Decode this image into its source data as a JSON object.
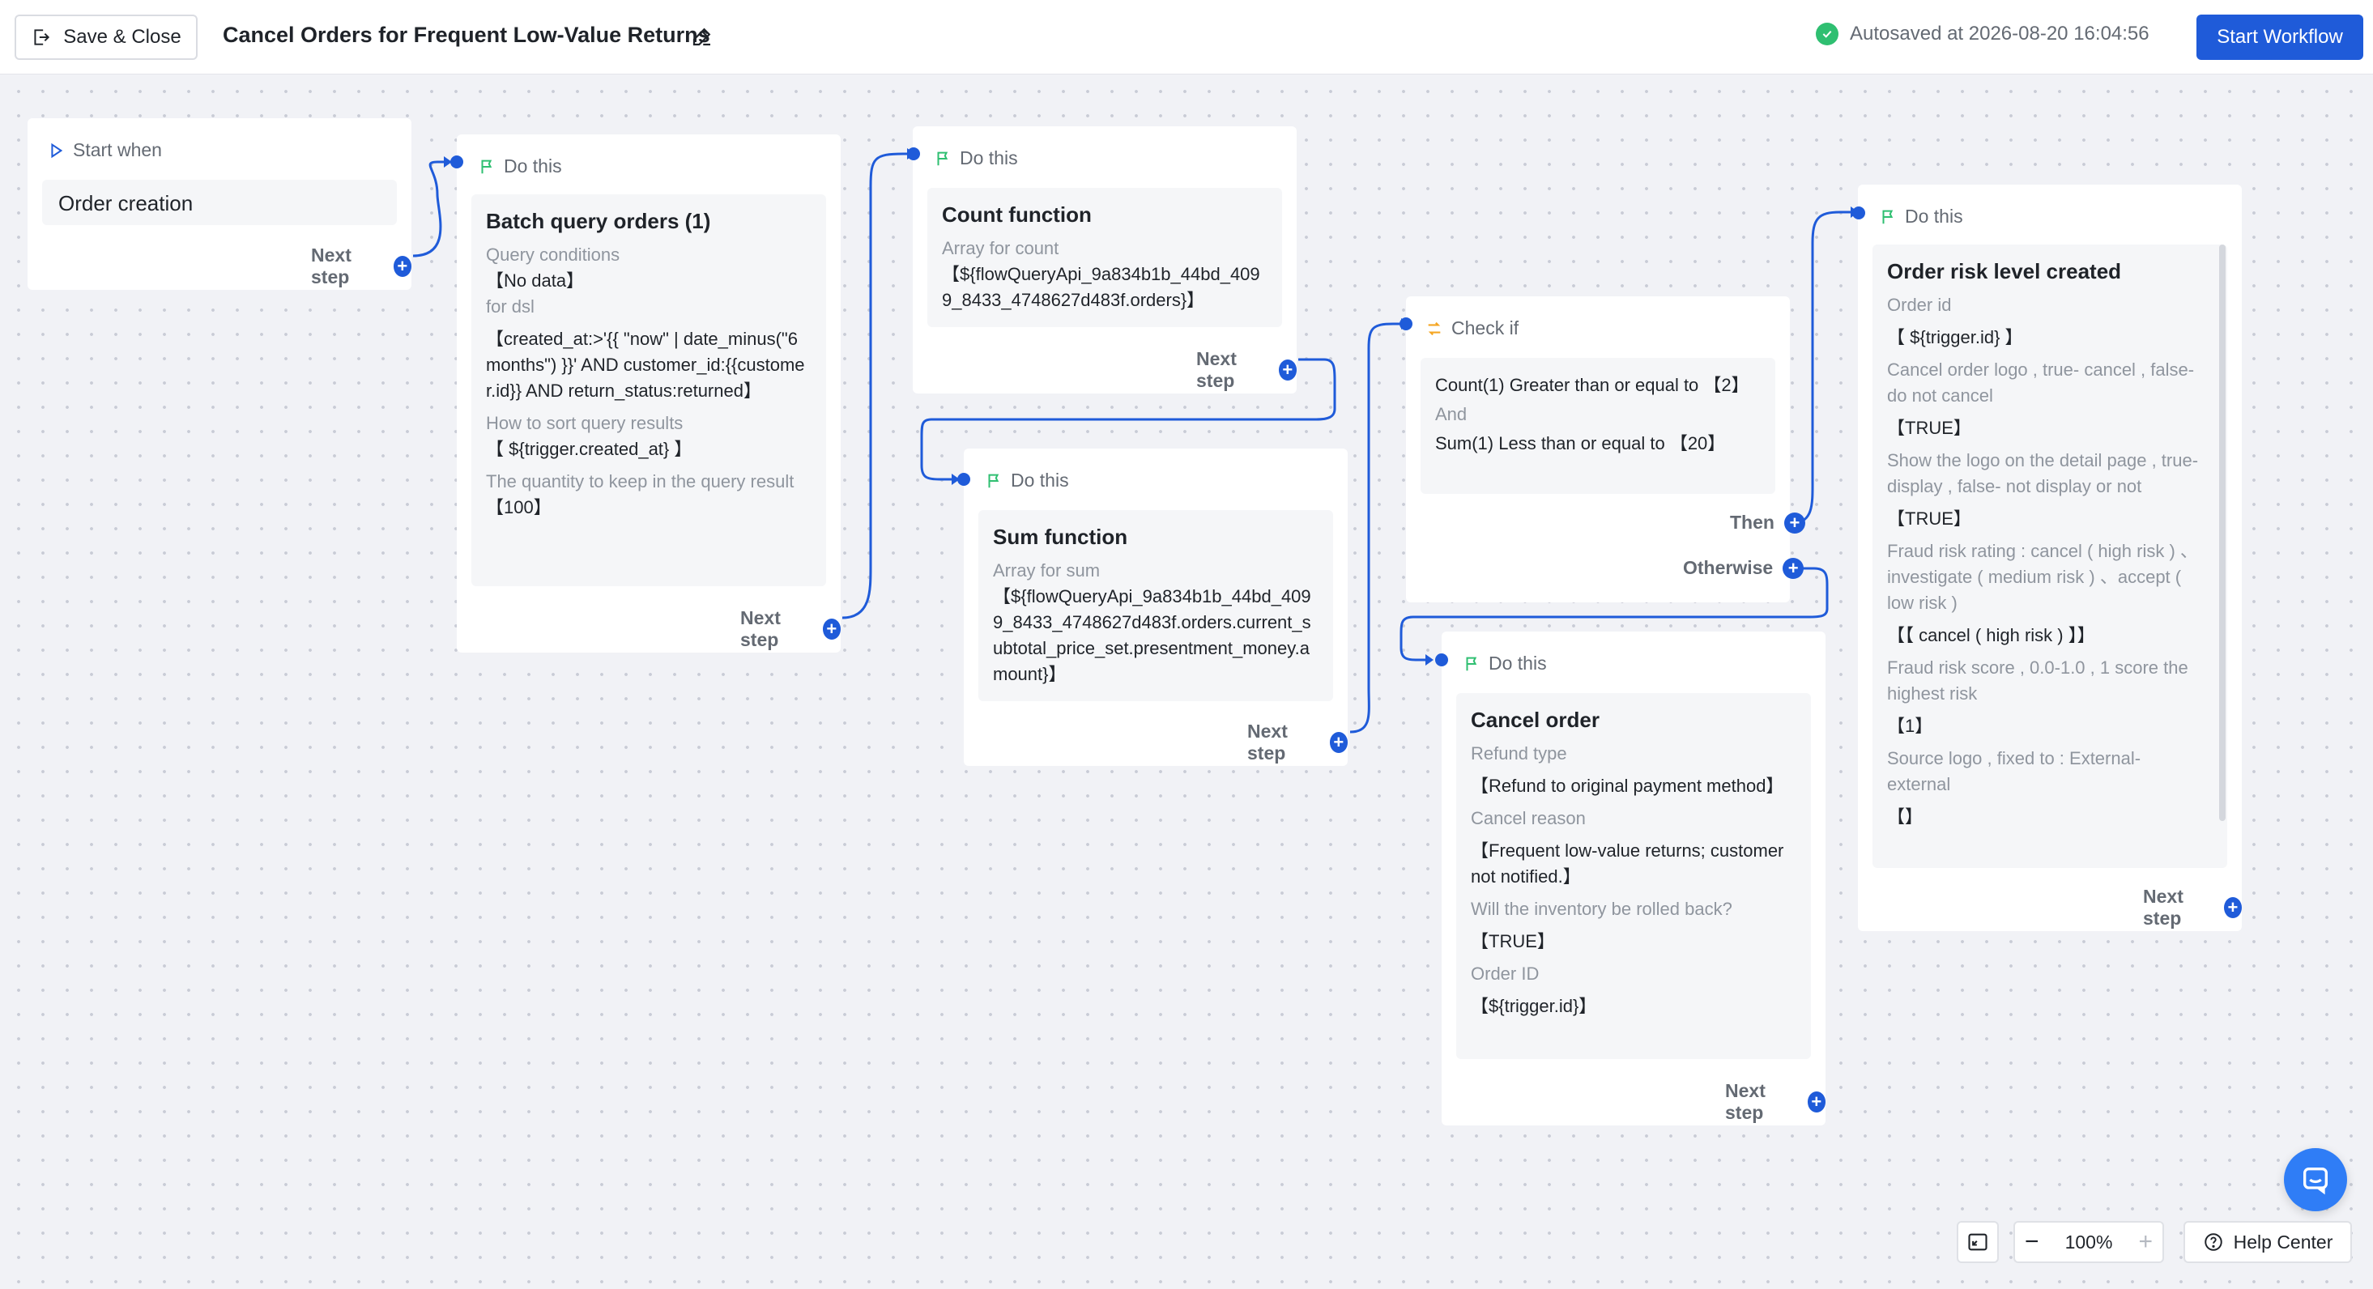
{
  "header": {
    "save_close_label": "Save & Close",
    "title": "Cancel Orders for Frequent Low-Value Returns",
    "autosave": "Autosaved at 2026-08-20 16:04:56",
    "start_label": "Start Workflow"
  },
  "colors": {
    "accent": "#1f5bd9",
    "success": "#2fbf71",
    "flag": "#2fbf71",
    "check": "#f5a623"
  },
  "nodes": {
    "start": {
      "head": "Start when",
      "title": "Order creation",
      "next": "Next step"
    },
    "batch": {
      "head": "Do this",
      "title": "Batch query orders (1)",
      "f1_label": "Query conditions",
      "f1_value": "【No data】",
      "f2_label": "for dsl",
      "f2_value": "【created_at:>'{{ \"now\" | date_minus(\"6 months\") }}' AND customer_id:{{customer.id}} AND return_status:returned】",
      "f3_label": "How to sort query results",
      "f3_value": "【 ${trigger.created_at} 】",
      "f4_label": "The quantity to keep in the query result",
      "f4_value": "【100】",
      "next": "Next step"
    },
    "count": {
      "head": "Do this",
      "title": "Count function",
      "f1_label": "Array for count",
      "f1_value": "【${flowQueryApi_9a834b1b_44bd_4099_8433_4748627d483f.orders}】",
      "next": "Next step"
    },
    "sum": {
      "head": "Do this",
      "title": "Sum function",
      "f1_label": "Array for sum",
      "f1_value": "【${flowQueryApi_9a834b1b_44bd_4099_8433_4748627d483f.orders.current_subtotal_price_set.presentment_money.amount}】",
      "next": "Next step"
    },
    "check": {
      "head": "Check if",
      "cond1": "Count(1) Greater than or equal to 【2】",
      "and": "And",
      "cond2": "Sum(1) Less than or equal to 【20】",
      "then": "Then",
      "otherwise": "Otherwise"
    },
    "cancel": {
      "head": "Do this",
      "title": "Cancel order",
      "f1_label": "Refund type",
      "f1_value": "【Refund to original payment method】",
      "f2_label": "Cancel reason",
      "f2_value": "【Frequent low-value returns; customer not notified.】",
      "f3_label": "Will the inventory be rolled back?",
      "f3_value": "【TRUE】",
      "f4_label": "Order ID",
      "f4_value": "【${trigger.id}】",
      "next": "Next step"
    },
    "risk": {
      "head": "Do this",
      "title": "Order risk level created",
      "f1_label": "Order id",
      "f1_value": "【 ${trigger.id} 】",
      "f2_label": "Cancel order logo , true- cancel , false- do not cancel",
      "f2_value": "【TRUE】",
      "f3_label": "Show the logo on the detail page , true- display , false- not display or not",
      "f3_value": "【TRUE】",
      "f4_label": "Fraud risk rating : cancel ( high risk ) 、investigate ( medium risk ) 、accept ( low risk )",
      "f4_value": "【【 cancel ( high risk ) 】】",
      "f5_label": "Fraud risk score , 0.0-1.0 , 1 score the highest risk",
      "f5_value": "【1】",
      "f6_label": "Source logo , fixed to : External-external",
      "f6_value": "【】",
      "next": "Next step"
    }
  },
  "toolbar": {
    "zoom": "100%",
    "help": "Help Center"
  }
}
